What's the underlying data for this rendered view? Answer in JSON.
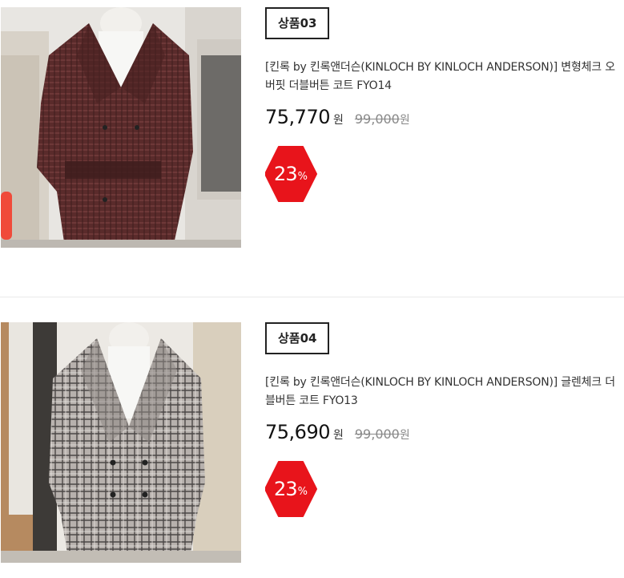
{
  "products": [
    {
      "badge": "상품03",
      "title": "[킨록 by 킨록앤더슨(KINLOCH BY KINLOCH ANDERSON)] 변형체크 오버핏 더블버튼 코트 FYO14",
      "price": "75,770",
      "price_unit": "원",
      "original_price": "99,000",
      "original_unit": "원",
      "discount": "23",
      "discount_unit": "%",
      "image_icon": "coat-photo-icon",
      "colors": {
        "coat": "#5a2b2b",
        "bg": "#e8e6e2"
      }
    },
    {
      "badge": "상품04",
      "title": "[킨록 by 킨록앤더슨(KINLOCH BY KINLOCH ANDERSON)] 글렌체크 더블버튼 코트 FYO13",
      "price": "75,690",
      "price_unit": "원",
      "original_price": "99,000",
      "original_unit": "원",
      "discount": "23",
      "discount_unit": "%",
      "image_icon": "coat-photo-icon",
      "colors": {
        "coat": "#8a8581",
        "bg": "#ece9e4"
      }
    }
  ],
  "colors": {
    "discount_badge": "#e8141b",
    "divider": "#e9e9e9"
  }
}
